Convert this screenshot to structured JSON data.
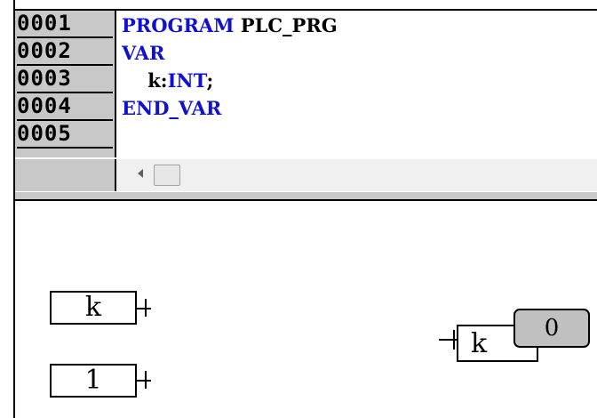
{
  "declaration": {
    "line_numbers": [
      "0001",
      "0002",
      "0003",
      "0004",
      "0005"
    ],
    "lines": [
      {
        "kw": "PROGRAM",
        "rest": " PLC_PRG"
      },
      {
        "kw": "VAR",
        "rest": ""
      },
      {
        "indent": "    ",
        "id": "k:",
        "kw": "INT",
        "rest": ";"
      },
      {
        "kw": "END_VAR",
        "rest": ""
      }
    ]
  },
  "cfc": {
    "input_box_1": "k",
    "input_box_2": "1",
    "output_box": "k",
    "online_value": "0"
  },
  "colors": {
    "keyword": "#1010d0",
    "gutter": "#c8c8c8",
    "value_box": "#c0c0c0"
  }
}
